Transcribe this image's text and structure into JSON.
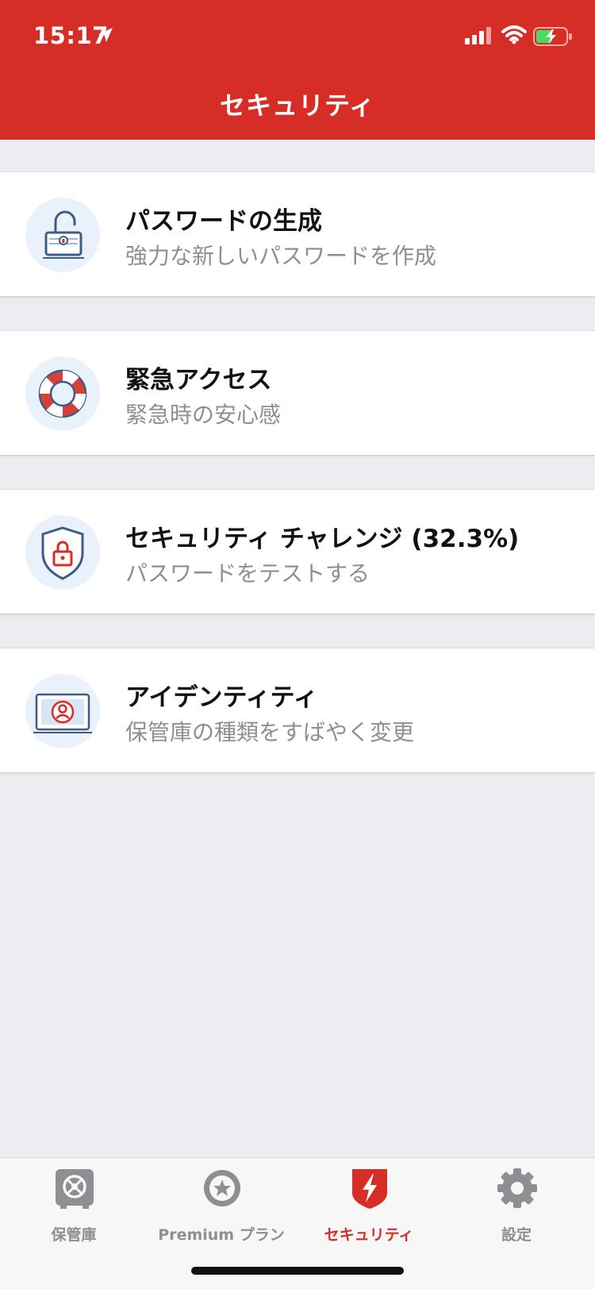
{
  "status_bar": {
    "time": "15:17"
  },
  "header": {
    "title": "セキュリティ"
  },
  "items": [
    {
      "title": "パスワードの生成",
      "subtitle": "強力な新しいパスワードを作成",
      "icon": "padlock-icon"
    },
    {
      "title": "緊急アクセス",
      "subtitle": "緊急時の安心感",
      "icon": "lifebuoy-icon"
    },
    {
      "title": "セキュリティ チャレンジ (32.3%)",
      "subtitle": "パスワードをテストする",
      "icon": "shield-lock-icon"
    },
    {
      "title": "アイデンティティ",
      "subtitle": "保管庫の種類をすばやく変更",
      "icon": "identity-card-icon"
    }
  ],
  "tabs": [
    {
      "label": "保管庫",
      "icon": "vault-icon"
    },
    {
      "label": "Premium プラン",
      "icon": "star-icon"
    },
    {
      "label": "セキュリティ",
      "icon": "security-bolt-icon",
      "active": true
    },
    {
      "label": "設定",
      "icon": "gear-icon"
    }
  ],
  "colors": {
    "brand": "#d62d27",
    "background": "#ececf1",
    "muted": "#8e8e93"
  }
}
